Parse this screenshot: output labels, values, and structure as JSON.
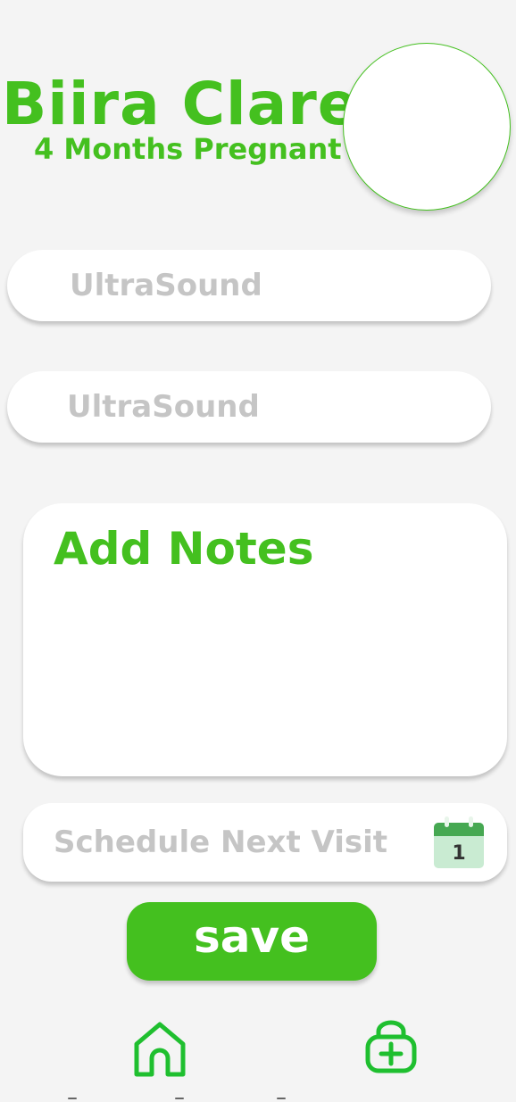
{
  "header": {
    "name": "Biira Clare",
    "status": "4 Months Pregnant"
  },
  "fields": [
    {
      "placeholder": "UltraSound"
    },
    {
      "placeholder": "UltraSound"
    }
  ],
  "notes": {
    "title": "Add Notes"
  },
  "schedule": {
    "label": "Schedule Next Visit",
    "calendar_day": "1",
    "icon": "calendar-icon"
  },
  "actions": {
    "save_label": "save"
  },
  "bottom_nav": {
    "items": [
      {
        "icon": "home-icon"
      },
      {
        "icon": "add-medical-bag-icon"
      }
    ]
  },
  "colors": {
    "accent": "#44c01f",
    "placeholder": "#c5c5c5",
    "background": "#f4f4f4"
  }
}
